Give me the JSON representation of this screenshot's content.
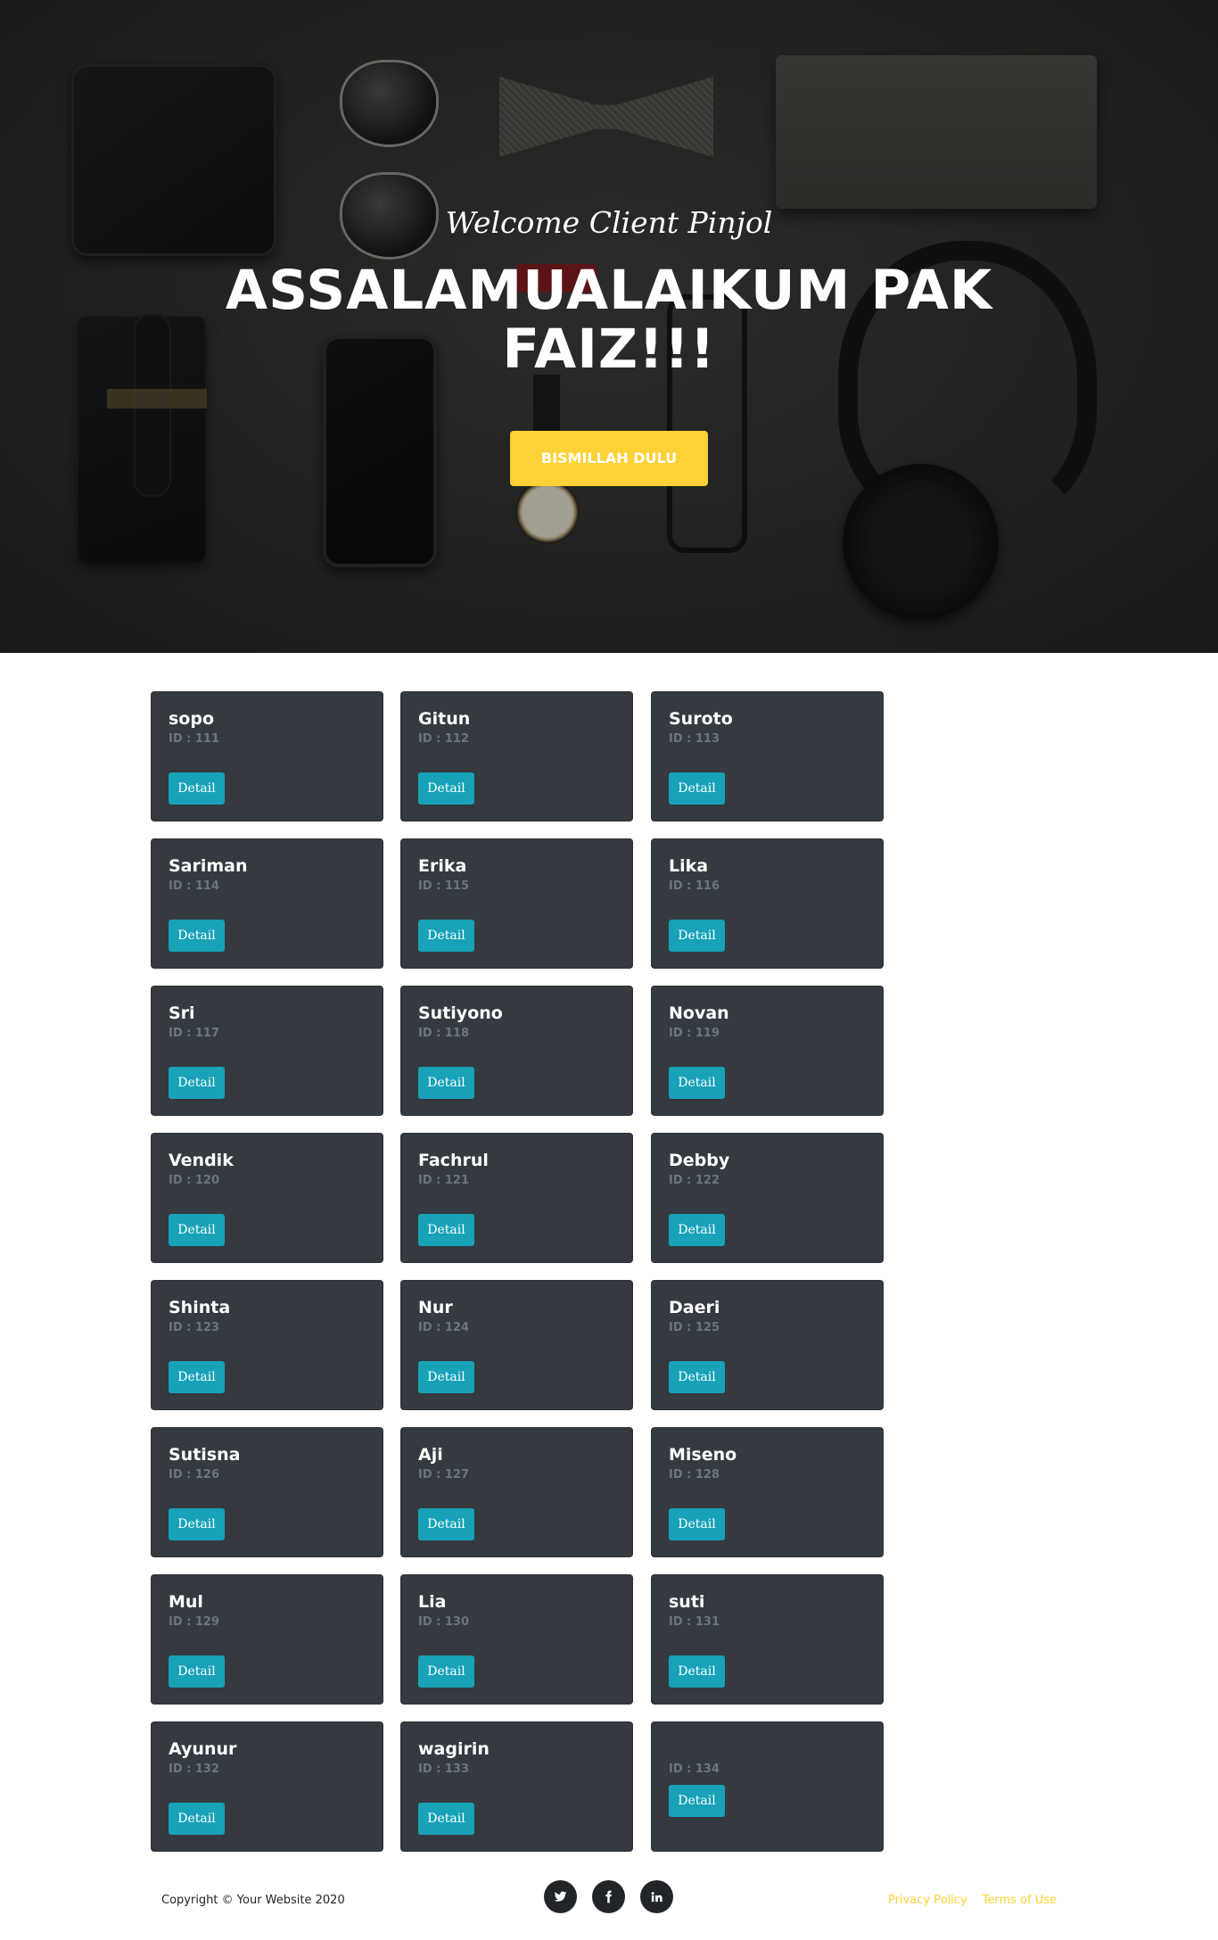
{
  "hero": {
    "subtitle": "Welcome Client Pinjol",
    "title": "ASSALAMUALAIKUM PAK FAIZ!!!",
    "button_label": "BISMILLAH DULU"
  },
  "colors": {
    "accent": "#fed136",
    "card_bg": "#343a40",
    "detail_button": "#17a2b8"
  },
  "detail_label": "Detail",
  "clients": [
    {
      "name": "sopo",
      "id": "ID : 111"
    },
    {
      "name": "Gitun",
      "id": "ID : 112"
    },
    {
      "name": "Suroto",
      "id": "ID : 113"
    },
    {
      "name": "Sariman",
      "id": "ID : 114"
    },
    {
      "name": "Erika",
      "id": "ID : 115"
    },
    {
      "name": "Lika",
      "id": "ID : 116"
    },
    {
      "name": "Sri",
      "id": "ID : 117"
    },
    {
      "name": "Sutiyono",
      "id": "ID : 118"
    },
    {
      "name": "Novan",
      "id": "ID : 119"
    },
    {
      "name": "Vendik",
      "id": "ID : 120"
    },
    {
      "name": "Fachrul",
      "id": "ID : 121"
    },
    {
      "name": "Debby",
      "id": "ID : 122"
    },
    {
      "name": "Shinta",
      "id": "ID : 123"
    },
    {
      "name": "Nur",
      "id": "ID : 124"
    },
    {
      "name": "Daeri",
      "id": "ID : 125"
    },
    {
      "name": "Sutisna",
      "id": "ID : 126"
    },
    {
      "name": "Aji",
      "id": "ID : 127"
    },
    {
      "name": "Miseno",
      "id": "ID : 128"
    },
    {
      "name": "Mul",
      "id": "ID : 129"
    },
    {
      "name": "Lia",
      "id": "ID : 130"
    },
    {
      "name": "suti",
      "id": "ID : 131"
    },
    {
      "name": "Ayunur",
      "id": "ID : 132"
    },
    {
      "name": "wagirin",
      "id": "ID : 133"
    },
    {
      "name": "",
      "id": "ID : 134"
    }
  ],
  "footer": {
    "copyright": "Copyright © Your Website 2020",
    "social": [
      {
        "icon": "twitter-icon"
      },
      {
        "icon": "facebook-icon"
      },
      {
        "icon": "linkedin-icon"
      }
    ],
    "links": [
      "Privacy Policy",
      "Terms of Use"
    ]
  }
}
